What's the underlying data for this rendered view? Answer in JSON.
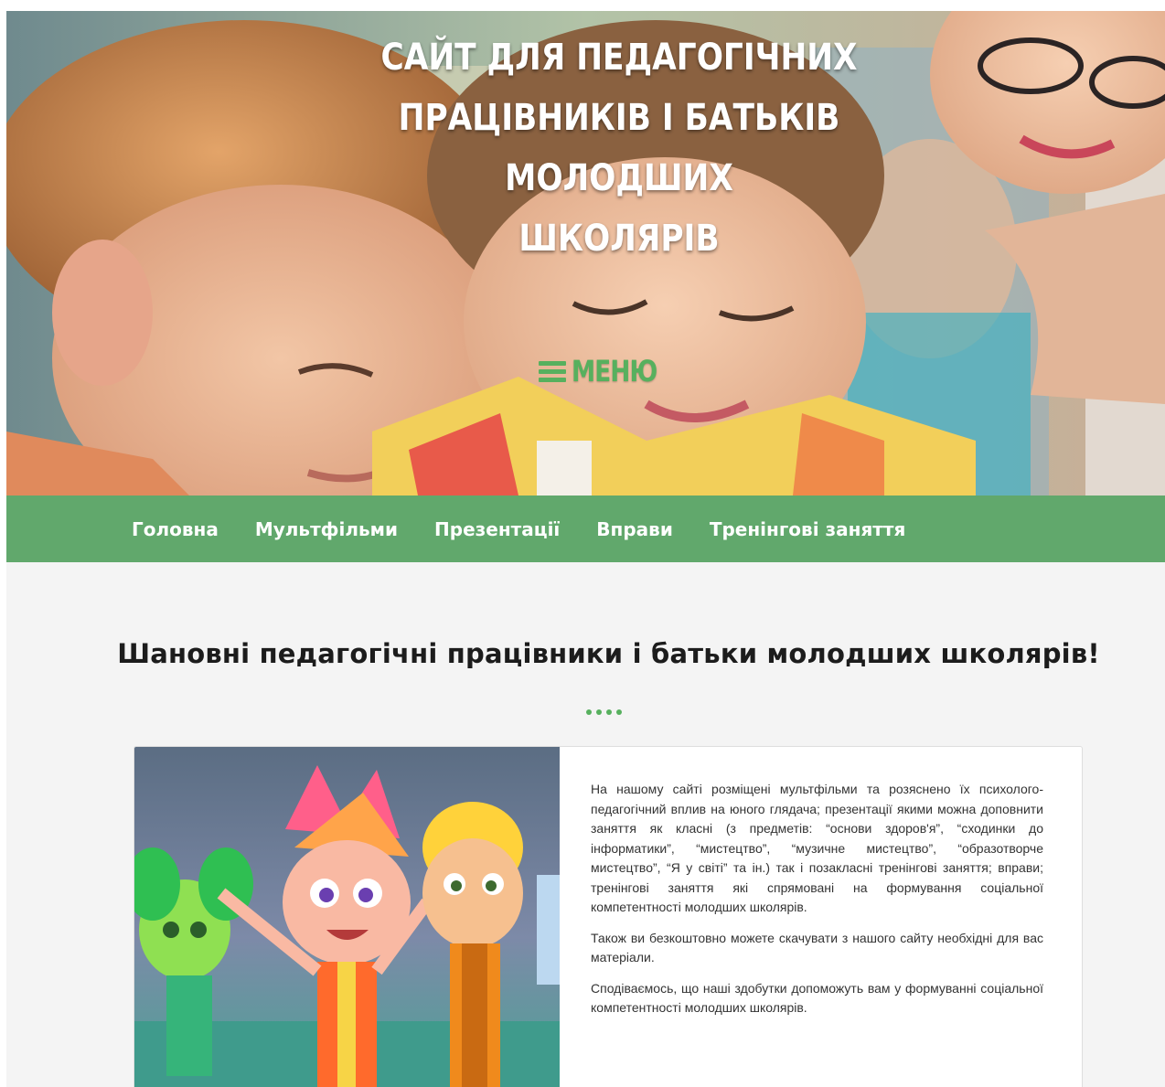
{
  "hero": {
    "title_line1": "САЙТ ДЛЯ ПЕДАГОГІЧНИХ",
    "title_line2": "ПРАЦІВНИКІВ І БАТЬКІВ МОЛОДШИХ",
    "title_line3": "ШКОЛЯРІВ",
    "menu_label": "МЕНЮ",
    "menu_icon": "hamburger-icon"
  },
  "nav": {
    "items": [
      {
        "label": "Головна"
      },
      {
        "label": "Мультфільми"
      },
      {
        "label": "Презентації"
      },
      {
        "label": "Вправи"
      },
      {
        "label": "Тренінгові заняття"
      }
    ]
  },
  "main": {
    "heading": "Шановні педагогічні працівники і батьки молодших школярів!",
    "paragraphs": [
      "На нашому сайті розміщені мультфільми та розяснено їх психолого-педагогічний вплив на юного глядача; презентації якими можна доповнити заняття як класні (з предметів: “основи здоров'я”, “сходинки до інформатики”, “мистецтво”, “музичне мистецтво”, “образотворче мистецтво”, “Я у світі” та ін.) так і позакласні тренінгові заняття; вправи; тренінгові заняття які спрямовані на формування соціальної компетентності молодших школярів.",
      "Також ви безкоштовно можете скачувати з нашого сайту необхідні для вас матеріали.",
      "Сподіваємось, що наші здобутки допоможуть вам у формуванні соціальної компетентності молодших школярів."
    ]
  },
  "colors": {
    "accent": "#61a86c",
    "menu_green": "#57b05e",
    "page_bg": "#f4f4f4",
    "heading": "#1c1c1c",
    "body_text": "#333333"
  }
}
